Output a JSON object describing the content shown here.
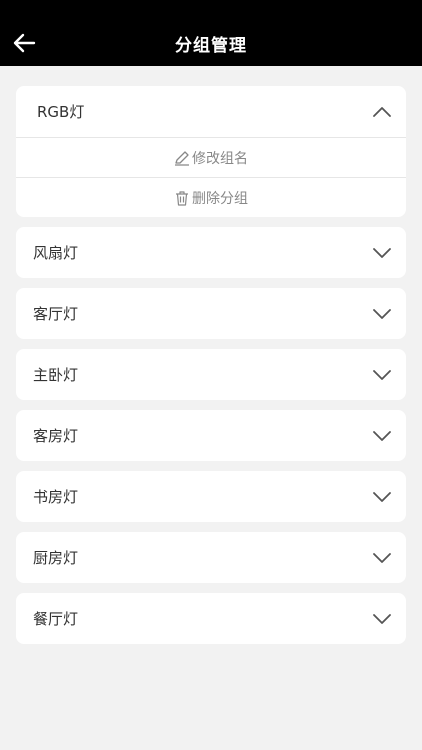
{
  "header": {
    "title": "分组管理"
  },
  "expanded_group": {
    "label": "RGB灯",
    "actions": [
      {
        "label": "修改组名",
        "icon": "edit-icon"
      },
      {
        "label": "删除分组",
        "icon": "trash-icon"
      }
    ]
  },
  "groups": [
    {
      "label": "风扇灯"
    },
    {
      "label": "客厅灯"
    },
    {
      "label": "主卧灯"
    },
    {
      "label": "客房灯"
    },
    {
      "label": "书房灯"
    },
    {
      "label": "厨房灯"
    },
    {
      "label": "餐厅灯"
    }
  ],
  "colors": {
    "header_bg": "#000000",
    "page_bg": "#f2f2f2",
    "card_bg": "#ffffff"
  }
}
